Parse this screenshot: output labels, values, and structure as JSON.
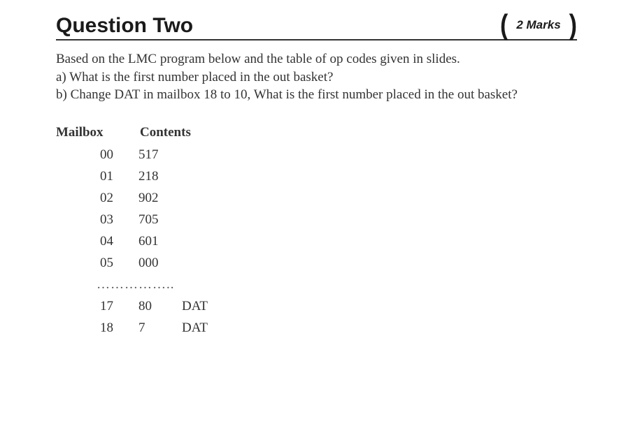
{
  "header": {
    "title": "Question Two",
    "marks": "2 Marks"
  },
  "prompt": {
    "intro": "Based on the LMC program below and the table of op codes given in slides.",
    "part_a": "a) What is the first number placed in the out basket?",
    "part_b": "b) Change DAT in mailbox 18 to 10, What is the first number placed in the out basket?"
  },
  "table": {
    "headers": {
      "mailbox": "Mailbox",
      "contents": "Contents"
    },
    "rows": [
      {
        "mailbox": "00",
        "contents": "517",
        "dat": ""
      },
      {
        "mailbox": "01",
        "contents": "218",
        "dat": ""
      },
      {
        "mailbox": "02",
        "contents": "902",
        "dat": ""
      },
      {
        "mailbox": "03",
        "contents": "705",
        "dat": ""
      },
      {
        "mailbox": "04",
        "contents": "601",
        "dat": ""
      },
      {
        "mailbox": "05",
        "contents": "000",
        "dat": ""
      }
    ],
    "ellipsis": "……………..",
    "data_rows": [
      {
        "mailbox": "17",
        "contents": "80",
        "dat": "DAT"
      },
      {
        "mailbox": "18",
        "contents": "7",
        "dat": "DAT"
      }
    ]
  }
}
